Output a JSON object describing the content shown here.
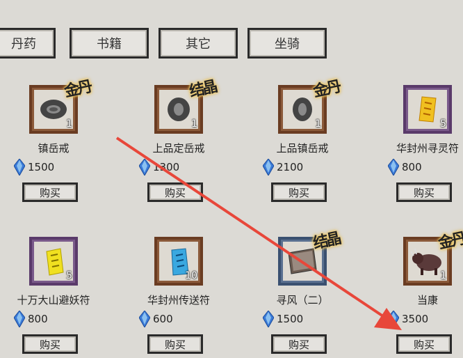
{
  "tabs": [
    "丹药",
    "书籍",
    "其它",
    "坐骑"
  ],
  "items": [
    {
      "name": "镇岳戒",
      "price": "1500",
      "qty": "1",
      "badge": "金丹",
      "buy": "购买",
      "icon": "ring-icon",
      "frame": "brown"
    },
    {
      "name": "上品定岳戒",
      "price": "1300",
      "qty": "1",
      "badge": "结晶",
      "buy": "购买",
      "icon": "ring-icon",
      "frame": "brown"
    },
    {
      "name": "上品镇岳戒",
      "price": "2100",
      "qty": "1",
      "badge": "金丹",
      "buy": "购买",
      "icon": "ring-icon",
      "frame": "brown"
    },
    {
      "name": "华封州寻灵符",
      "price": "800",
      "qty": "5",
      "badge": "",
      "buy": "购买",
      "icon": "talisman-icon",
      "frame": "purple"
    },
    {
      "name": "十万大山避妖符",
      "price": "800",
      "qty": "5",
      "badge": "",
      "buy": "购买",
      "icon": "talisman-icon",
      "frame": "purple"
    },
    {
      "name": "华封州传送符",
      "price": "600",
      "qty": "10",
      "badge": "",
      "buy": "购买",
      "icon": "talisman-icon",
      "frame": "brown"
    },
    {
      "name": "寻风（二）",
      "price": "1500",
      "qty": "",
      "badge": "结晶",
      "buy": "购买",
      "icon": "book-icon",
      "frame": "blue"
    },
    {
      "name": "当康",
      "price": "3500",
      "qty": "1",
      "badge": "金丹",
      "buy": "购买",
      "icon": "beast-icon",
      "frame": "brown"
    }
  ],
  "colors": {
    "arrow": "#e8473a",
    "gem": "#3a7ad8",
    "talisman_yellow": "#f0c020",
    "talisman_blue": "#3aa8e0"
  }
}
